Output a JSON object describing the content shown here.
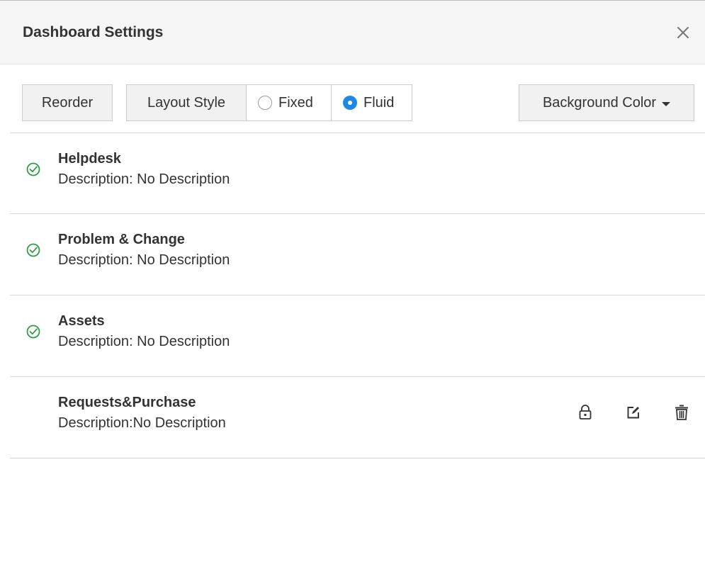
{
  "header": {
    "title": "Dashboard Settings",
    "close_icon": "close-icon"
  },
  "toolbar": {
    "reorder_label": "Reorder",
    "layout_style_label": "Layout Style",
    "layout_options": [
      {
        "label": "Fixed",
        "selected": false
      },
      {
        "label": "Fluid",
        "selected": true
      }
    ],
    "background_color_label": "Background Color",
    "background_color_icon": "caret-down-icon"
  },
  "dashboards": [
    {
      "name": "Helpdesk",
      "description": "Description: No Description",
      "active": true,
      "icon": "check-circle-icon"
    },
    {
      "name": "Problem & Change",
      "description": "Description: No Description",
      "active": true,
      "icon": "check-circle-icon"
    },
    {
      "name": "Assets",
      "description": "Description: No Description",
      "active": true,
      "icon": "check-circle-icon"
    },
    {
      "name": "Requests&Purchase",
      "description": "Description:No Description",
      "active": false,
      "actions": [
        "lock-icon",
        "edit-icon",
        "trash-icon"
      ]
    }
  ],
  "colors": {
    "accent": "#1e88e5",
    "check": "#2e9d42",
    "header_bg": "#f5f5f5"
  }
}
